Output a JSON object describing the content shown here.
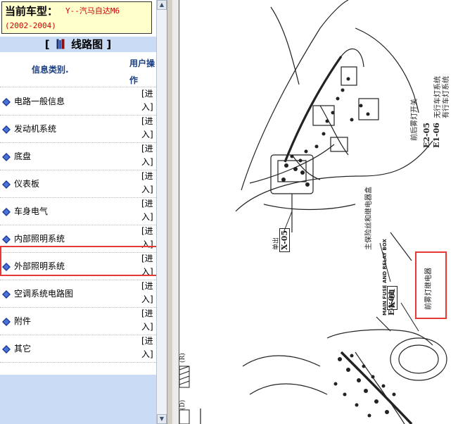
{
  "vehicle": {
    "label": "当前车型：",
    "model": "Y--汽马自达M6",
    "years": "(2002-2004)"
  },
  "panel_title": {
    "left_bracket": "[",
    "text": "线路图",
    "right_bracket": "]"
  },
  "columns": {
    "category": "信息类别.",
    "action": "用户操作"
  },
  "categories": [
    {
      "label": "电路一般信息",
      "action": "[进入]"
    },
    {
      "label": "发动机系统",
      "action": "[进入]"
    },
    {
      "label": "底盘",
      "action": "[进入]"
    },
    {
      "label": "仪表板",
      "action": "[进入]"
    },
    {
      "label": "车身电气",
      "action": "[进入]"
    },
    {
      "label": "内部照明系统",
      "action": "[进入]"
    },
    {
      "label": "外部照明系统",
      "action": "[进入]"
    },
    {
      "label": "空调系统电路图",
      "action": "[进入]"
    },
    {
      "label": "附件",
      "action": "[进入]"
    },
    {
      "label": "其它",
      "action": "[进入]"
    }
  ],
  "selected_category": "外部照明系统",
  "diagram": {
    "labels": {
      "turn_switch": "前后雾灯开关",
      "lamp_system": "无行车灯系统",
      "lamp_system_2": "有行车灯系统",
      "connector_e2": "E2-05",
      "connector_e1": "E1-06",
      "main_fuse": "主保险丝和继电器盒",
      "connector_x05": "X-05",
      "connector_x05_prefix": "单出",
      "relay_box_en": "MAIN FUSE AND RELAY BOX",
      "connector_x01": "X-01",
      "connector_e401": "E4-01",
      "fog_relay": "前雾灯继电器",
      "edge_marks": "(D)",
      "edge_marks_2": "(R)"
    }
  },
  "colors": {
    "highlight": "#e53935",
    "title_band": "#c9dbf5",
    "header_bg": "#ffffcc",
    "model_text": "#cc0000",
    "column_head": "#1a3e80"
  }
}
